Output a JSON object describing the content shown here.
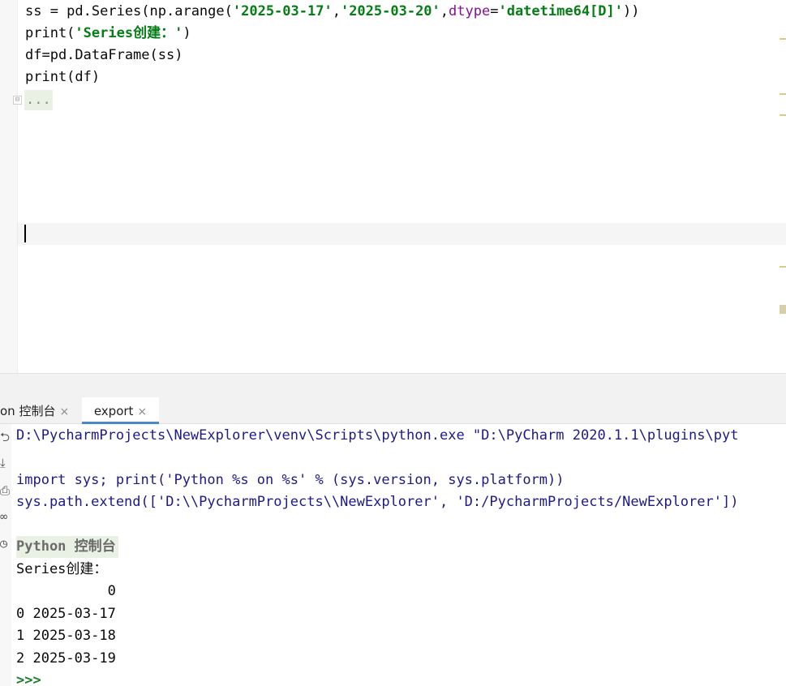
{
  "editor": {
    "lines": [
      {
        "segments": [
          {
            "t": "ss = pd.Series(np.arange(",
            "c": ""
          },
          {
            "t": "'2025-03-17'",
            "c": "tk-str"
          },
          {
            "t": ",",
            "c": ""
          },
          {
            "t": "'2025-03-20'",
            "c": "tk-str"
          },
          {
            "t": ",",
            "c": ""
          },
          {
            "t": "dtype",
            "c": "tk-kw"
          },
          {
            "t": "=",
            "c": ""
          },
          {
            "t": "'datetime64[D]'",
            "c": "tk-str"
          },
          {
            "t": "))",
            "c": ""
          }
        ]
      },
      {
        "segments": [
          {
            "t": "print(",
            "c": ""
          },
          {
            "t": "'Series创建：'",
            "c": "tk-str"
          },
          {
            "t": ")",
            "c": ""
          }
        ]
      },
      {
        "segments": [
          {
            "t": "df=pd.DataFrame(ss)",
            "c": ""
          }
        ]
      },
      {
        "segments": [
          {
            "t": "print(df)",
            "c": ""
          }
        ]
      }
    ],
    "folded_placeholder": "...",
    "fold_marker": "⊟"
  },
  "tabs": [
    {
      "label": "on 控制台",
      "close": "×"
    },
    {
      "label": "export",
      "close": "×"
    }
  ],
  "console": {
    "toolbar_icons": [
      "soft-wrap-icon",
      "scroll-to-end-icon",
      "print-icon",
      "glasses-icon",
      "history-icon"
    ],
    "toolbar_glyphs": [
      "⮌",
      "⤓",
      "⎙",
      "∞",
      "◷"
    ],
    "lines": [
      {
        "text": "D:\\PycharmProjects\\NewExplorer\\venv\\Scripts\\python.exe \"D:\\PyCharm 2020.1.1\\plugins\\pyt",
        "cls": "c-cmd"
      },
      {
        "text": "",
        "cls": "c-cmd"
      },
      {
        "text": "import sys; print('Python %s on %s' % (sys.version, sys.platform))",
        "cls": "c-cmd"
      },
      {
        "text": "sys.path.extend(['D:\\\\PycharmProjects\\\\NewExplorer', 'D:/PycharmProjects/NewExplorer'])",
        "cls": "c-cmd"
      },
      {
        "text": "",
        "cls": "c-cmd"
      },
      {
        "text": "Python 控制台",
        "cls": "c-banner"
      },
      {
        "text": "Series创建：",
        "cls": "c-out"
      },
      {
        "text": "           0",
        "cls": "c-out"
      },
      {
        "text": "0 2025-03-17",
        "cls": "c-out"
      },
      {
        "text": "1 2025-03-18",
        "cls": "c-out"
      },
      {
        "text": "2 2025-03-19",
        "cls": "c-out"
      },
      {
        "text": ">>>",
        "cls": "c-prompt"
      }
    ]
  },
  "colors": {
    "string": "#067d17",
    "keyword": "#871094",
    "console_command": "#1d1a86",
    "prompt": "#1a7f2a",
    "tab_underline": "#4a88c7"
  }
}
